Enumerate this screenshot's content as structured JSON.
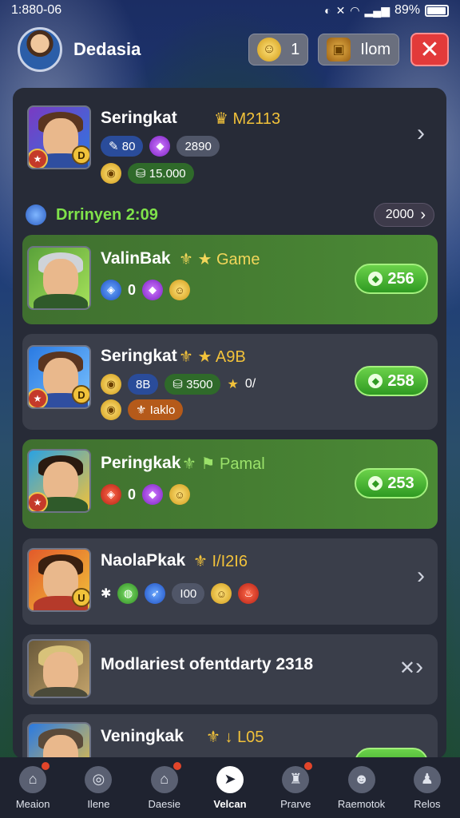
{
  "status_bar": {
    "time": "1:880-06",
    "battery": "89%"
  },
  "header": {
    "user_name": "Dedasia",
    "coin_value": "1",
    "chest_label": "Ilom"
  },
  "section": {
    "title": "Drrinyen 2:09",
    "chip": "2000"
  },
  "cards": [
    {
      "name": "Seringkat",
      "tag": "M2113",
      "chip1": "80",
      "chip2": "2890",
      "reward_chip": "15.000",
      "badge": "D"
    },
    {
      "name": "ValinBak",
      "tag": "Game",
      "value": "0",
      "reward": "256"
    },
    {
      "name": "Seringkat",
      "tag": "A9B",
      "chip1": "8B",
      "chip2": "3500",
      "extra": "0/",
      "reward_chip": "Iaklo",
      "badge": "D",
      "reward": "258"
    },
    {
      "name": "Peringkak",
      "tag": "Pamal",
      "value": "0",
      "reward": "253"
    },
    {
      "name": "NaolaPkak",
      "tag": "I/I2I6",
      "chip": "I00",
      "badge": "U"
    },
    {
      "name": "Modlariest ofentdarty 2318"
    },
    {
      "name": "Veningkak",
      "tag": "L05"
    }
  ],
  "nav": [
    {
      "label": "Meaion"
    },
    {
      "label": "Ilene"
    },
    {
      "label": "Daesie"
    },
    {
      "label": "Velcan"
    },
    {
      "label": "Prarve"
    },
    {
      "label": "Raemotok"
    },
    {
      "label": "Relos"
    }
  ]
}
